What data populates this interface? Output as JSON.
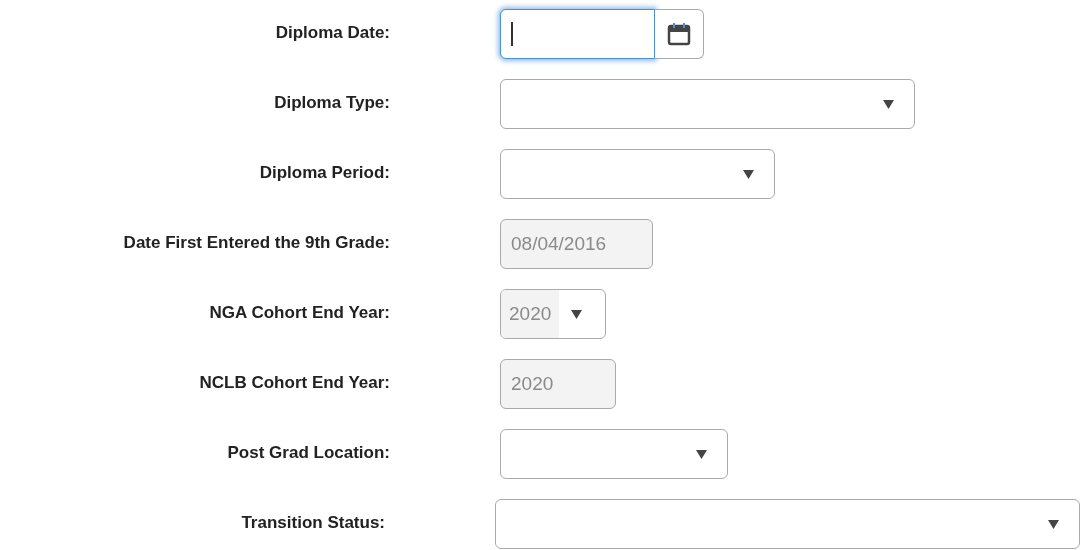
{
  "fields": [
    {
      "label": "Diploma Date:",
      "kind": "date",
      "disabled": false,
      "focused": true
    },
    {
      "label": "Diploma Type:",
      "kind": "select",
      "disabled": false,
      "focused": false
    },
    {
      "label": "Diploma Period:",
      "kind": "select",
      "disabled": false,
      "focused": false
    },
    {
      "label": "Date First Entered the 9th Grade:",
      "kind": "text",
      "value": "08/04/2016",
      "disabled": true,
      "focused": false
    },
    {
      "label": "NGA Cohort End Year:",
      "kind": "select",
      "value": "2020",
      "disabled": true,
      "focused": false
    },
    {
      "label": "NCLB Cohort End Year:",
      "kind": "text",
      "value": "2020",
      "disabled": true,
      "focused": false
    },
    {
      "label": "Post Grad Location:",
      "kind": "select",
      "disabled": false,
      "focused": false
    },
    {
      "label": "Transition Status:",
      "kind": "select",
      "disabled": false,
      "focused": false
    }
  ]
}
